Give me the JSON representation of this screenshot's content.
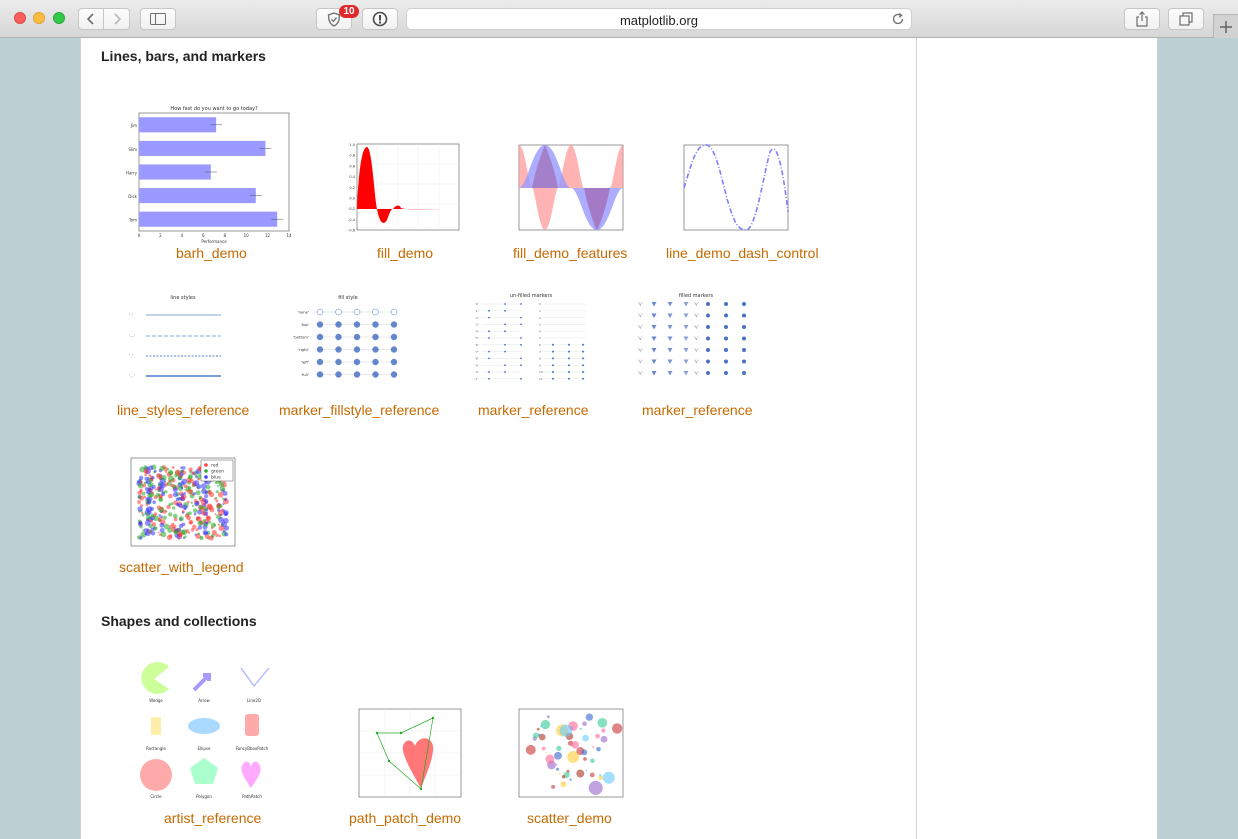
{
  "browser": {
    "url": "matplotlib.org",
    "notification_count": "10"
  },
  "sections": [
    {
      "title": "Lines, bars, and markers"
    },
    {
      "title": "Shapes and collections"
    }
  ],
  "gallery": {
    "barh_demo": {
      "label": "barh_demo",
      "title": "How fast do you want to go today?",
      "xlabel": "Performance",
      "categories": [
        "Jim",
        "Slim",
        "Harry",
        "Dick",
        "Tom"
      ],
      "values": [
        7.2,
        11.8,
        6.7,
        10.9,
        12.9
      ],
      "xticks": [
        "0",
        "2",
        "4",
        "6",
        "8",
        "10",
        "12",
        "14"
      ]
    },
    "fill_demo": {
      "label": "fill_demo",
      "yticks": [
        "1.0",
        "0.8",
        "0.6",
        "0.4",
        "0.2",
        "0.0",
        "-0.2",
        "-0.4",
        "-0.6"
      ]
    },
    "fill_demo_features": {
      "label": "fill_demo_features"
    },
    "line_demo_dash_control": {
      "label": "line_demo_dash_control"
    },
    "line_styles_reference": {
      "label": "line_styles_reference",
      "title": "line styles"
    },
    "marker_fillstyle_reference": {
      "label": "marker_fillstyle_reference",
      "title": "fill style",
      "row_labels": [
        "'none'",
        "'top'",
        "'bottom'",
        "'right'",
        "'left'",
        "'full'"
      ]
    },
    "marker_reference_unfilled": {
      "label": "marker_reference",
      "title": "un-filled markers"
    },
    "marker_reference_filled": {
      "label": "marker_reference",
      "title": "filled markers"
    },
    "scatter_with_legend": {
      "label": "scatter_with_legend",
      "legend": [
        "red",
        "green",
        "blue"
      ]
    },
    "artist_reference": {
      "label": "artist_reference",
      "captions": [
        "Wedge",
        "Arrow",
        "Line2D",
        "Rectangle",
        "Ellipse",
        "FancyBboxPatch",
        "Circle",
        "Polygon",
        "PathPatch"
      ]
    },
    "path_patch_demo": {
      "label": "path_patch_demo"
    },
    "scatter_demo": {
      "label": "scatter_demo"
    }
  },
  "colors": {
    "link": "#c56a00",
    "bar": "#9999ff",
    "fill_red": "#ff0000",
    "marker_blue": "#4a72c4"
  }
}
